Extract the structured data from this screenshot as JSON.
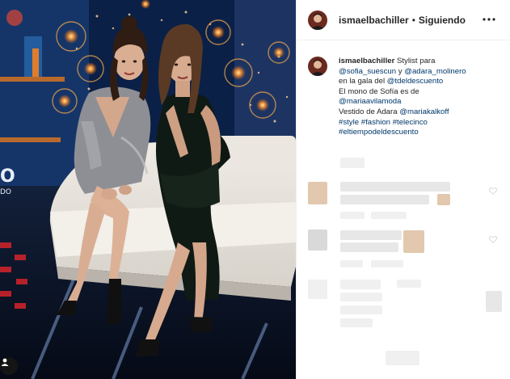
{
  "post": {
    "username": "ismaelbachiller",
    "separator": "•",
    "follow_status": "Siguiendo",
    "caption": {
      "lines": [
        [
          "ismaelbachiller",
          " Stylist para"
        ],
        [
          "@sofia_suescun",
          " y ",
          "@adara_molinero"
        ],
        [
          "en la gala del ",
          "@tdeldescuento"
        ],
        [
          "El mono de Sofía es de"
        ],
        [
          "@mariaavilamoda"
        ],
        [
          "Vestido de Adara ",
          "@mariakalkoff"
        ],
        [
          "#style",
          " ",
          "#fashion",
          " ",
          "#telecinco"
        ],
        [
          "#eltiempodeldescuento"
        ]
      ]
    }
  },
  "icons": {
    "avatar": "profile-photo",
    "more": "more-options-icon",
    "tagged": "user-tag-icon",
    "like": "heart-icon"
  },
  "colors": {
    "link": "#00376b",
    "text": "#262626",
    "border": "#efefef",
    "stage_blue": "#0d2850",
    "sofa": "#e9e5df"
  }
}
